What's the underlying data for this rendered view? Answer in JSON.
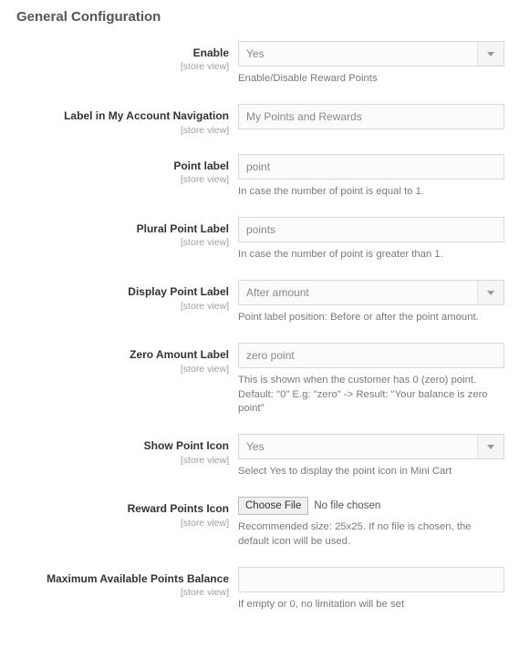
{
  "section_title": "General Configuration",
  "scope_label": "[store view]",
  "fields": {
    "enable": {
      "label": "Enable",
      "value": "Yes",
      "comment": "Enable/Disable Reward Points"
    },
    "nav_label": {
      "label": "Label in My Account Navigation",
      "value": "My Points and Rewards"
    },
    "point_label": {
      "label": "Point label",
      "value": "point",
      "comment": "In case the number of point is equal to 1."
    },
    "plural_point_label": {
      "label": "Plural Point Label",
      "value": "points",
      "comment": "In case the number of point is greater than 1."
    },
    "display_point_label": {
      "label": "Display Point Label",
      "value": "After amount",
      "comment": "Point label position: Before or after the point amount."
    },
    "zero_amount_label": {
      "label": "Zero Amount Label",
      "value": "zero point",
      "comment": "This is shown when the customer has 0 (zero) point. Default: \"0\" E.g: \"zero\" -> Result: \"Your balance is zero point\""
    },
    "show_point_icon": {
      "label": "Show Point Icon",
      "value": "Yes",
      "comment": "Select Yes to display the point icon in Mini Cart"
    },
    "reward_points_icon": {
      "label": "Reward Points Icon",
      "button": "Choose File",
      "status": "No file chosen",
      "comment": "Recommended size: 25x25. If no file is chosen, the default icon will be used."
    },
    "max_balance": {
      "label": "Maximum Available Points Balance",
      "value": "",
      "comment": "If empty or 0, no limitation will be set"
    }
  }
}
